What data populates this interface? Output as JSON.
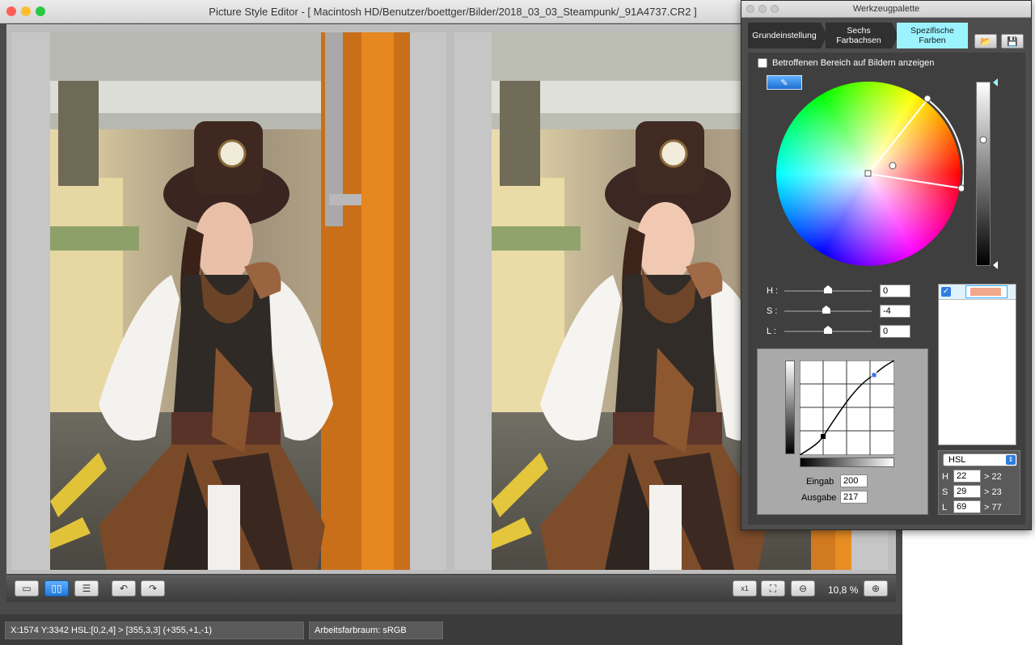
{
  "window": {
    "title": "Picture Style Editor - [ Macintosh HD/Benutzer/boettger/Bilder/2018_03_03_Steampunk/_91A4737.CR2 ]",
    "traffic_colors": [
      "#fe5f57",
      "#febc2e",
      "#28c840"
    ]
  },
  "toolbar": {
    "zoom_value": "10,8 %",
    "single_view_icon": "single-view-icon",
    "split_view_icon": "side-by-side-view-icon",
    "stacked_view_icon": "top-bottom-view-icon",
    "rotate_left_icon": "rotate-left-icon",
    "rotate_right_icon": "rotate-right-icon",
    "fit_x1_icon": "actual-size-icon",
    "fit_window_icon": "fit-to-window-icon",
    "zoom_out_icon": "zoom-out-icon",
    "zoom_in_icon": "zoom-in-icon",
    "active_color": "#2a88ee"
  },
  "status": {
    "coords": "X:1574 Y:3342  HSL:[0,2,4] > [355,3,3]  (+355,+1,-1)",
    "colorspace": "Arbeitsfarbraum: sRGB"
  },
  "palette": {
    "title": "Werkzeugpalette",
    "tabs": [
      {
        "label_line1": "Grundeinstellung",
        "label_line2": ""
      },
      {
        "label_line1": "Sechs",
        "label_line2": "Farbachsen"
      },
      {
        "label_line1": "Spezifische",
        "label_line2": "Farben"
      }
    ],
    "active_tab_color": "#9af3ff",
    "show_area_label": "Betroffenen Bereich auf Bildern anzeigen",
    "sliders": [
      {
        "label": "H :",
        "value": "0",
        "position": 0.5
      },
      {
        "label": "S :",
        "value": "-4",
        "position": 0.48
      },
      {
        "label": "L :",
        "value": "0",
        "position": 0.5
      }
    ],
    "curve": {
      "input_label": "Eingab",
      "input_value": "200",
      "output_label": "Ausgabe",
      "output_value": "217"
    },
    "color_list": {
      "swatch_color": "#f2a88a",
      "checked": true
    },
    "hsl": {
      "mode": "HSL",
      "rows": [
        {
          "label": "H",
          "value": "22",
          "result": "> 22"
        },
        {
          "label": "S",
          "value": "29",
          "result": "> 23"
        },
        {
          "label": "L",
          "value": "69",
          "result": "> 77"
        }
      ]
    }
  }
}
